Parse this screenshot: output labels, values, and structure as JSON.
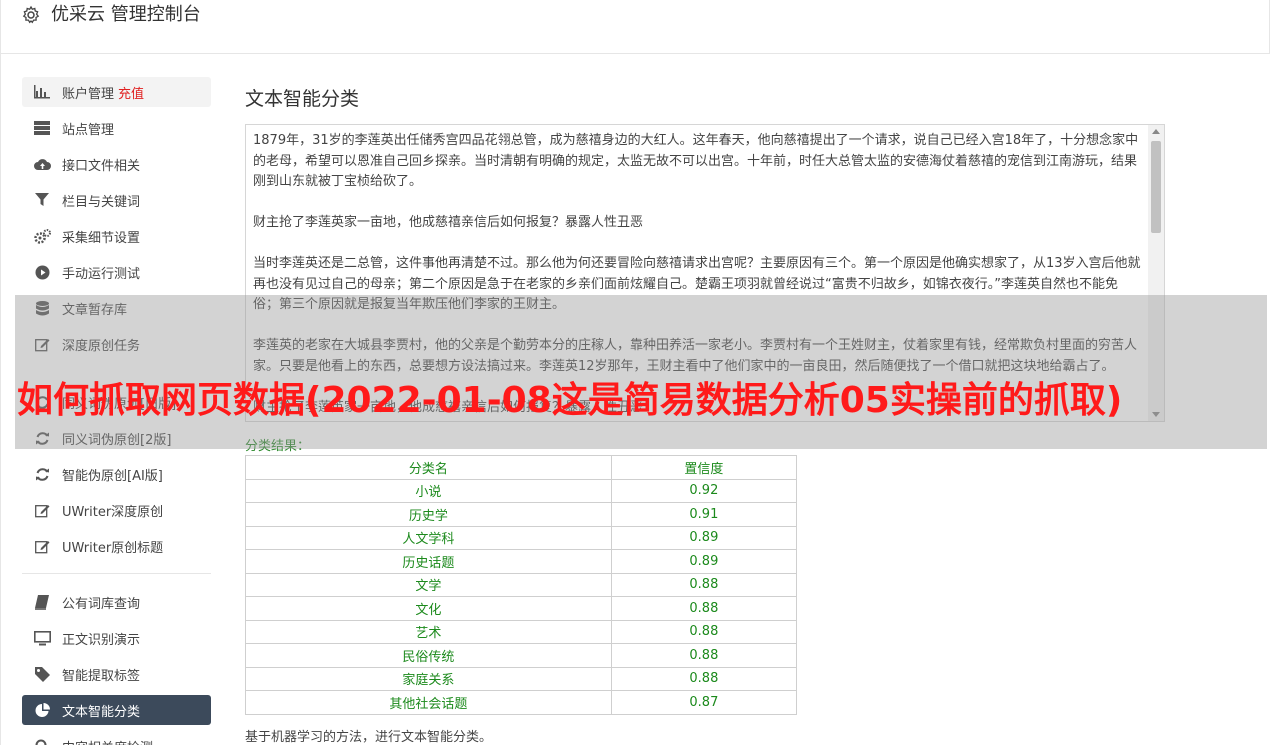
{
  "header": {
    "title": "优采云 管理控制台",
    "icon": "gear-icon"
  },
  "sidebar": {
    "items": [
      {
        "label": "账户管理",
        "extra": "充值",
        "icon": "bar-chart-icon",
        "state": "hover"
      },
      {
        "label": "站点管理",
        "icon": "server-icon"
      },
      {
        "label": "接口文件相关",
        "icon": "cloud-upload-icon"
      },
      {
        "label": "栏目与关键词",
        "icon": "filter-icon"
      },
      {
        "label": "采集细节设置",
        "icon": "cogs-icon"
      },
      {
        "label": "手动运行测试",
        "icon": "play-circle-icon"
      },
      {
        "label": "文章暂存库",
        "icon": "database-icon"
      },
      {
        "label": "深度原创任务",
        "icon": "edit-icon"
      },
      {
        "label": "同义词伪原创[旧版]",
        "icon": "refresh-icon"
      },
      {
        "label": "同义词伪原创[2版]",
        "icon": "refresh-icon"
      },
      {
        "label": "智能伪原创[AI版]",
        "icon": "refresh-icon"
      },
      {
        "label": "UWriter深度原创",
        "icon": "edit-icon"
      },
      {
        "label": "UWriter原创标题",
        "icon": "edit-icon"
      },
      {
        "label": "公有词库查询",
        "icon": "book-icon"
      },
      {
        "label": "正文识别演示",
        "icon": "monitor-icon"
      },
      {
        "label": "智能提取标签",
        "icon": "tag-icon"
      },
      {
        "label": "文本智能分类",
        "icon": "pie-chart-icon",
        "state": "active"
      },
      {
        "label": "内容相关度检测",
        "icon": "search-icon"
      }
    ]
  },
  "main": {
    "title": "文本智能分类",
    "paragraphs": [
      "1879年，31岁的李莲英出任储秀宫四品花翎总管，成为慈禧身边的大红人。这年春天，他向慈禧提出了一个请求，说自己已经入宫18年了，十分想念家中的老母，希望可以恩准自己回乡探亲。当时清朝有明确的规定，太监无故不可以出宫。十年前，时任大总管太监的安德海仗着慈禧的宠信到江南游玩，结果刚到山东就被丁宝桢给砍了。",
      "财主抢了李莲英家一亩地，他成慈禧亲信后如何报复？暴露人性丑恶",
      "当时李莲英还是二总管，这件事他再清楚不过。那么他为何还要冒险向慈禧请求出宫呢？主要原因有三个。第一个原因是他确实想家了，从13岁入宫后他就再也没有见过自己的母亲；第二个原因是急于在老家的乡亲们面前炫耀自己。楚霸王项羽就曾经说过“富贵不归故乡，如锦衣夜行。”李莲英自然也不能免俗；第三个原因就是报复当年欺压他们李家的王财主。",
      "李莲英的老家在大城县李贾村，他的父亲是个勤劳本分的庄稼人，靠种田养活一家老小。李贾村有一个王姓财主，仗着家里有钱，经常欺负村里面的穷苦人家。只要是他看上的东西，总要想方设法搞过来。李莲英12岁那年，王财主看中了他们家中的一亩良田，然后随便找了一个借口就把这块地给霸占了。",
      "财主抢了李莲英家一亩地，他成慈禧亲信后如何报复？暴露人性丑恶"
    ],
    "result_label": "分类结果：",
    "table_headers": [
      "分类名",
      "置信度"
    ],
    "rows": [
      [
        "小说",
        "0.92"
      ],
      [
        "历史学",
        "0.91"
      ],
      [
        "人文学科",
        "0.89"
      ],
      [
        "历史话题",
        "0.89"
      ],
      [
        "文学",
        "0.88"
      ],
      [
        "文化",
        "0.88"
      ],
      [
        "艺术",
        "0.88"
      ],
      [
        "民俗传统",
        "0.88"
      ],
      [
        "家庭关系",
        "0.88"
      ],
      [
        "其他社会话题",
        "0.87"
      ]
    ],
    "footnote": "基于机器学习的方法，进行文本智能分类。"
  },
  "overlay": {
    "text": "如何抓取网页数据(2022-01-08这是简易数据分析05实操前的抓取)"
  },
  "colors": {
    "active_bg": "#3c4a5b",
    "result_green": "#1c8a1c",
    "overlay_red": "#ff1a1a",
    "badge_red": "#e02020"
  }
}
